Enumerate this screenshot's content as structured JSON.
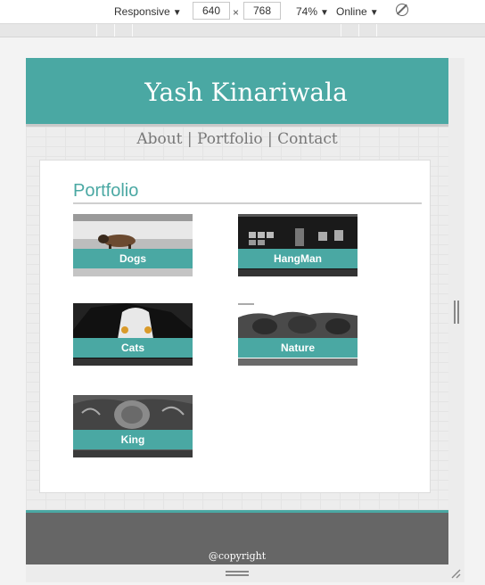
{
  "devtools": {
    "device_mode": "Responsive",
    "width": "640",
    "times": "×",
    "height": "768",
    "zoom": "74%",
    "network": "Online",
    "caret": "▼"
  },
  "site": {
    "title": "Yash Kinariwala",
    "nav": {
      "about": "About",
      "sep": "|",
      "portfolio": "Portfolio",
      "contact": "Contact"
    },
    "section_title": "Portfolio",
    "projects": [
      {
        "label": "Dogs"
      },
      {
        "label": "HangMan"
      },
      {
        "label": "Cats"
      },
      {
        "label": "Nature"
      },
      {
        "label": "King"
      }
    ],
    "footer": "@copyright"
  },
  "colors": {
    "accent": "#4aa8a3",
    "footer": "#666666"
  }
}
